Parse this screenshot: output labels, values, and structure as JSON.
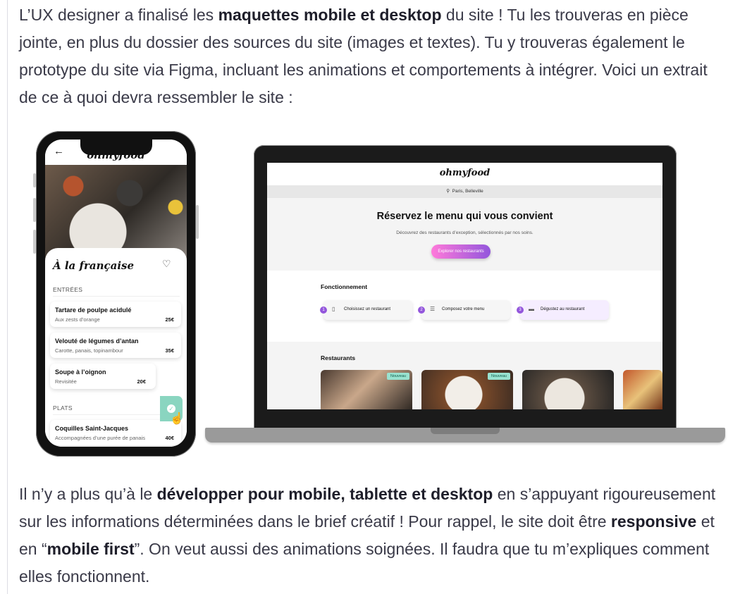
{
  "intro": {
    "s1": "L’UX designer a finalisé les ",
    "b1": "maquettes mobile et desktop",
    "s2": " du site ! Tu les trouveras en pièce jointe, en plus du dossier des sources du site (images et textes). Tu y trouveras également le prototype du site via Figma, incluant les animations et comportements à intégrer. Voici un extrait de ce à quoi devra ressembler le site :"
  },
  "mobile": {
    "back_icon": "←",
    "logo": "ohmyfood",
    "title": "À la française",
    "heart_icon": "♡",
    "sections": [
      "ENTRÉES",
      "PLATS"
    ],
    "dishes": [
      {
        "name": "Tartare de poulpe acidulé",
        "desc": "Aux zests d’orange",
        "price": "25€"
      },
      {
        "name": "Velouté de légumes d’antan",
        "desc": "Carotte, panais, topinambour",
        "price": "35€"
      },
      {
        "name": "Soupe à l’oignon",
        "desc": "Revisitée",
        "price": "20€"
      },
      {
        "name": "Coquilles Saint-Jacques",
        "desc": "Accompagnées d’une purée de panais",
        "price": "40€"
      }
    ],
    "check_icon": "✓",
    "cursor_icon": "☝"
  },
  "desktop": {
    "logo": "ohmyfood",
    "location": "Paris, Belleville",
    "location_icon": "⚲",
    "hero_title": "Réservez le menu qui vous convient",
    "hero_sub": "Découvrez des restaurants d’exception, sélectionnés par nos soins.",
    "cta": "Explorer nos restaurants",
    "how_title": "Fonctionnement",
    "steps": [
      {
        "num": "1",
        "icon": "▯",
        "label": "Choisissez un restaurant"
      },
      {
        "num": "2",
        "icon": "☰",
        "label": "Composez votre menu"
      },
      {
        "num": "3",
        "icon": "▬",
        "label": "Dégustez au restaurant"
      }
    ],
    "rest_title": "Restaurants",
    "badge": "Nouveau"
  },
  "outro": {
    "s1": "Il n’y a plus qu’à le ",
    "b1": "développer pour mobile, tablette et desktop",
    "s2": " en s’appuyant rigoureusement sur les informations déterminées dans le brief créatif ! Pour rappel, le site doit être ",
    "b2": "responsive",
    "s3": " et en “",
    "b3": "mobile first",
    "s4": "”. On veut aussi des animations soignées. Il faudra que tu m’expliques comment elles fonctionnent."
  },
  "colors": {
    "accent_pink": "#ff79da",
    "accent_purple": "#9356dc",
    "mint": "#99e2d0"
  }
}
